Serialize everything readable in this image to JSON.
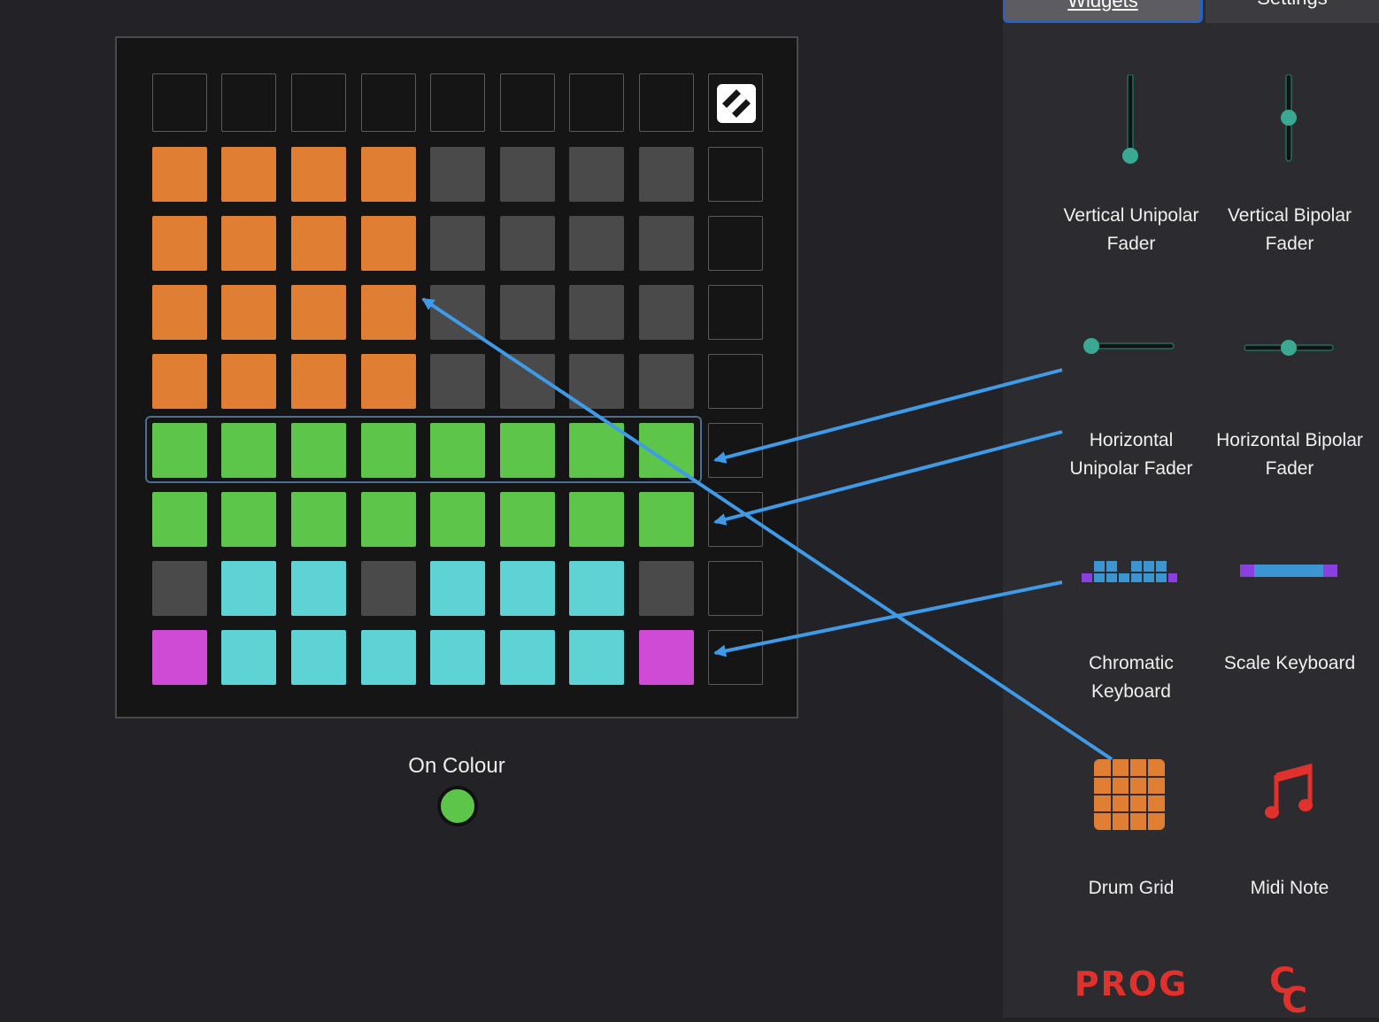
{
  "tabs": [
    {
      "label": "Widgets",
      "active": true
    },
    {
      "label": "Settings",
      "active": false
    }
  ],
  "grid": {
    "logo_icon": "novation-logo-icon",
    "rows": [
      [
        "empty",
        "empty",
        "empty",
        "empty",
        "empty",
        "empty",
        "empty",
        "empty"
      ],
      [
        "orange",
        "orange",
        "orange",
        "orange",
        "grey",
        "grey",
        "grey",
        "grey",
        "empty"
      ],
      [
        "orange",
        "orange",
        "orange",
        "orange",
        "grey",
        "grey",
        "grey",
        "grey",
        "empty"
      ],
      [
        "orange",
        "orange",
        "orange",
        "orange",
        "grey",
        "grey",
        "grey",
        "grey",
        "empty"
      ],
      [
        "orange",
        "orange",
        "orange",
        "orange",
        "grey",
        "grey",
        "grey",
        "grey",
        "empty"
      ],
      [
        "green",
        "green",
        "green",
        "green",
        "green",
        "green",
        "green",
        "green",
        "empty"
      ],
      [
        "green",
        "green",
        "green",
        "green",
        "green",
        "green",
        "green",
        "green",
        "empty"
      ],
      [
        "grey",
        "cyan",
        "cyan",
        "grey",
        "cyan",
        "cyan",
        "cyan",
        "grey",
        "empty"
      ],
      [
        "magenta",
        "cyan",
        "cyan",
        "cyan",
        "cyan",
        "cyan",
        "cyan",
        "magenta",
        "empty"
      ]
    ],
    "selected_row": 5
  },
  "colors": {
    "orange": "#e07f33",
    "grey": "#4a4a4a",
    "green": "#5dc64a",
    "cyan": "#5dd3d6",
    "magenta": "#cf4bd6",
    "teal": "#3aa892",
    "arrow": "#3f9be8",
    "red": "#e0312c",
    "keyboard_blue": "#3b95d0",
    "keyboard_purple": "#8a3fe0"
  },
  "on_colour": {
    "label": "On Colour",
    "value": "#5dc64a"
  },
  "widgets": [
    {
      "id": "vertical-unipolar-fader",
      "label_lines": [
        "Vertical Unipolar",
        "Fader"
      ],
      "icon": "vertical-unipolar-fader-icon"
    },
    {
      "id": "vertical-bipolar-fader",
      "label_lines": [
        "Vertical Bipolar",
        "Fader"
      ],
      "icon": "vertical-bipolar-fader-icon"
    },
    {
      "id": "horizontal-unipolar-fader",
      "label_lines": [
        "Horizontal",
        "Unipolar Fader"
      ],
      "icon": "horizontal-unipolar-fader-icon"
    },
    {
      "id": "horizontal-bipolar-fader",
      "label_lines": [
        "Horizontal Bipolar",
        "Fader"
      ],
      "icon": "horizontal-bipolar-fader-icon"
    },
    {
      "id": "chromatic-keyboard",
      "label_lines": [
        "Chromatic",
        "Keyboard"
      ],
      "icon": "chromatic-keyboard-icon"
    },
    {
      "id": "scale-keyboard",
      "label_lines": [
        "Scale Keyboard"
      ],
      "icon": "scale-keyboard-icon"
    },
    {
      "id": "drum-grid",
      "label_lines": [
        "Drum Grid"
      ],
      "icon": "drum-grid-icon"
    },
    {
      "id": "midi-note",
      "label_lines": [
        "Midi Note"
      ],
      "icon": "music-note-icon"
    },
    {
      "id": "prog",
      "label_lines": [],
      "icon_text": "PROG",
      "icon": "prog-icon"
    },
    {
      "id": "cc",
      "label_lines": [],
      "icon_text": "CC",
      "icon": "cc-icon"
    }
  ]
}
